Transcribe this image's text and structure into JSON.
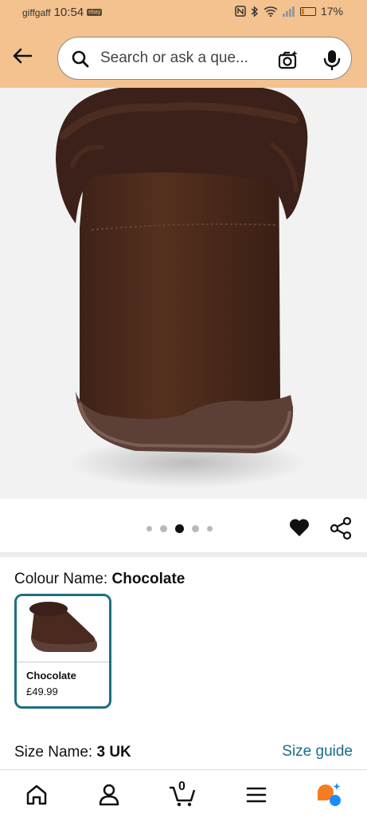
{
  "status_bar": {
    "carrier": "giffgaff",
    "time": "10:54",
    "notification": "ebay",
    "battery": "17%",
    "battery_level": 0.17
  },
  "search": {
    "placeholder": "Search or ask a que..."
  },
  "gallery": {
    "image_count": 5,
    "active_index": 2
  },
  "variation": {
    "colour_label": "Colour Name:",
    "colour_value": "Chocolate",
    "options": [
      {
        "name": "Chocolate",
        "price": "£49.99"
      }
    ],
    "size_label": "Size Name:",
    "size_value": "3 UK",
    "size_guide": "Size guide"
  },
  "bottom_nav": {
    "cart_count": "0"
  },
  "colors": {
    "header_bg": "#f4c28e",
    "swatch_border": "#1f6f80",
    "link": "#1a6b8a"
  }
}
